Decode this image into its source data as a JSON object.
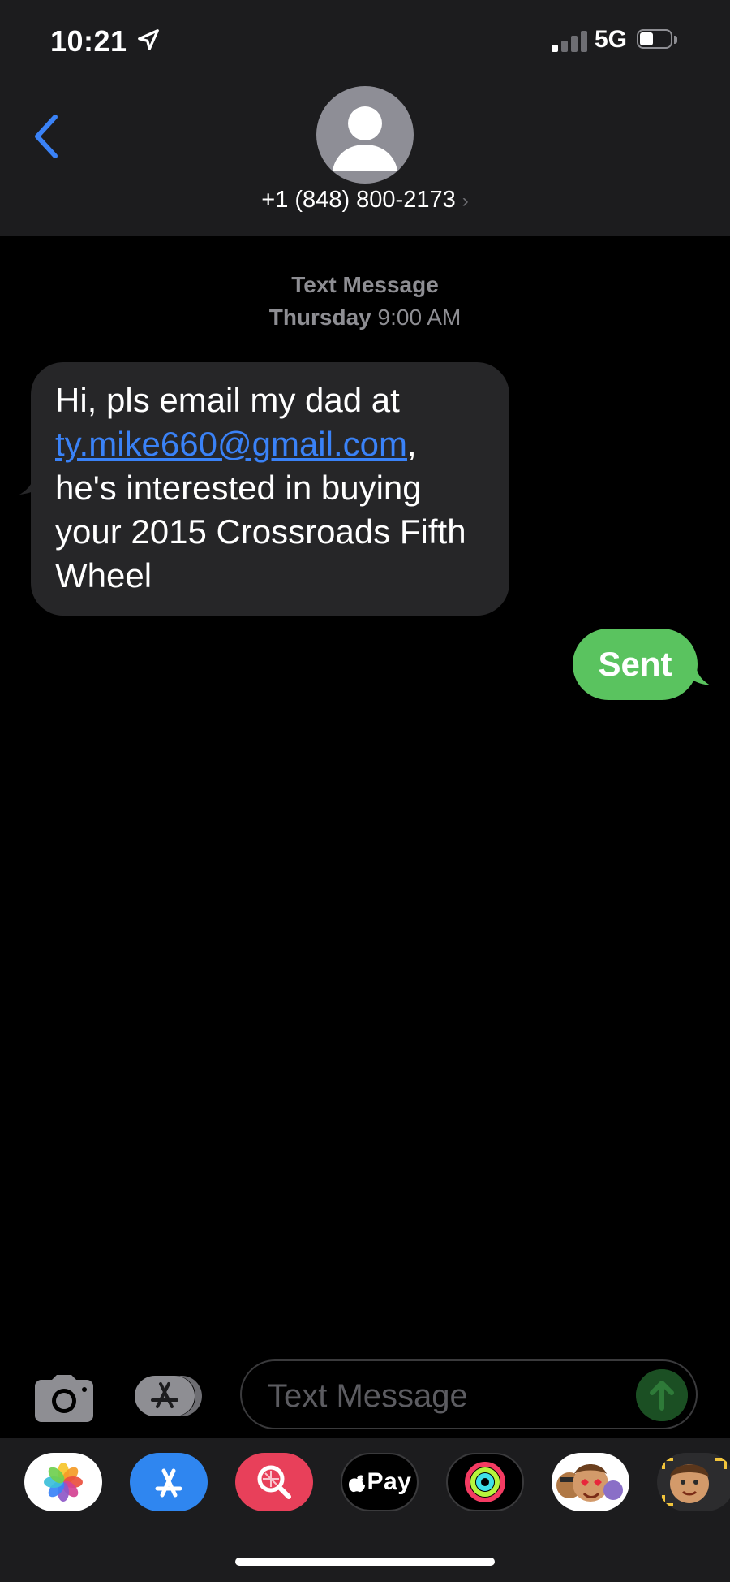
{
  "status_bar": {
    "time": "10:21",
    "network": "5G",
    "location_icon": "location-arrow-icon",
    "signal_icon": "cellular-signal-icon",
    "battery_icon": "battery-icon",
    "battery_level": 0.45
  },
  "header": {
    "back_icon": "chevron-left-icon",
    "avatar_icon": "person-silhouette-icon",
    "contact": "+1 (848) 800-2173",
    "contact_chevron": "›",
    "accent_color": "#3a82f7"
  },
  "conversation": {
    "service_label": "Text Message",
    "date_day": "Thursday",
    "date_time": "9:00 AM",
    "incoming": {
      "text_before": "Hi, pls email my dad at ",
      "link": "ty.mike660@gmail.com",
      "text_after": ", he's interested in buying your 2015 Crossroads Fifth Wheel",
      "bubble_color": "#262628",
      "link_color": "#3a82f7"
    },
    "outgoing": {
      "text": "Sent",
      "bubble_color": "#5ac35f"
    }
  },
  "composer": {
    "camera_icon": "camera-icon",
    "apps_icon": "app-store-icon",
    "placeholder": "Text Message",
    "value": "",
    "send_icon": "arrow-up-icon"
  },
  "app_strip": {
    "apps": [
      {
        "name": "photos-app-icon"
      },
      {
        "name": "app-store-app-icon"
      },
      {
        "name": "search-images-app-icon"
      },
      {
        "name": "apple-pay-app-icon",
        "label": "Pay"
      },
      {
        "name": "activity-app-icon"
      },
      {
        "name": "memoji-stickers-app-icon"
      },
      {
        "name": "memoji-app-icon"
      }
    ]
  }
}
